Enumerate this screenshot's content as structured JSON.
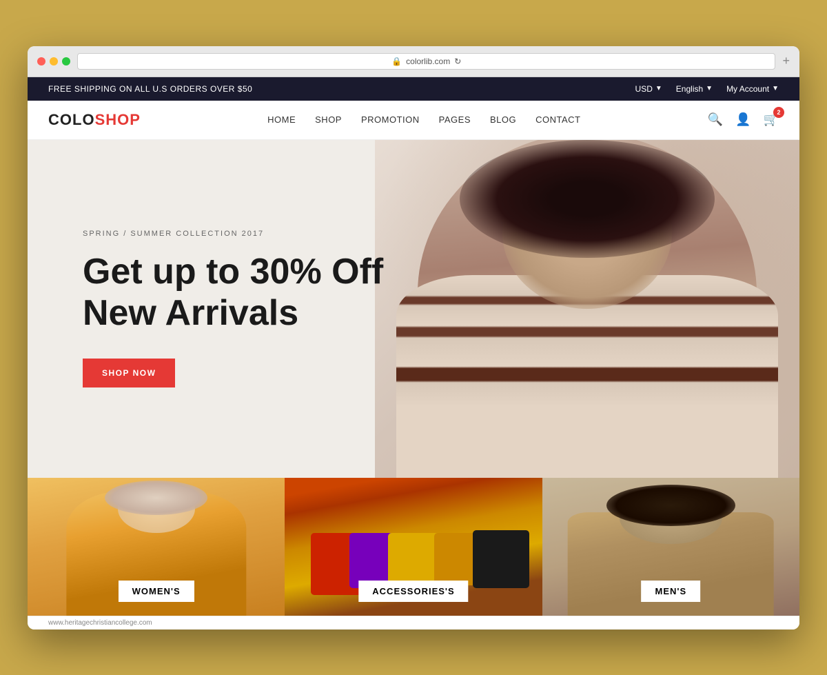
{
  "browser": {
    "url": "colorlib.com",
    "add_btn": "+"
  },
  "announcement": {
    "text": "FREE SHIPPING ON ALL U.S ORDERS OVER $50",
    "currency": "USD",
    "language": "English",
    "account": "My Account"
  },
  "nav": {
    "logo_colo": "COLO",
    "logo_shop": "SHOP",
    "links": [
      "HOME",
      "SHOP",
      "PROMOTION",
      "PAGES",
      "BLOG",
      "CONTACT"
    ],
    "cart_count": "2"
  },
  "hero": {
    "subtitle": "SPRING / SUMMER COLLECTION 2017",
    "title_line1": "Get up to 30% Off",
    "title_line2": "New Arrivals",
    "cta_label": "SHOP NOW"
  },
  "categories": [
    {
      "label": "WOMEN'S",
      "bg": "women"
    },
    {
      "label": "ACCESSORIES'S",
      "bg": "accessories"
    },
    {
      "label": "MEN'S",
      "bg": "men"
    }
  ],
  "status_bar": {
    "url": "www.heritagechristiancollege.com"
  }
}
